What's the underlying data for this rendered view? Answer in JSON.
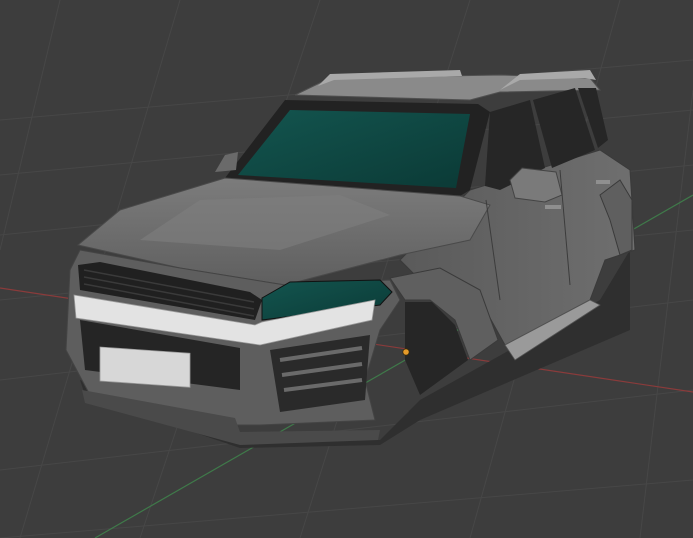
{
  "viewport": {
    "background": "#3d3d3d",
    "grid_color": "#474747",
    "x_axis_color": "#8a3b3b",
    "y_axis_color": "#3f7a4a"
  },
  "model": {
    "body_color": "#6e6e6e",
    "body_dark": "#4f4f4f",
    "glass_color": "#0f4a45",
    "chrome_color": "#e3e3e3",
    "trim_color": "#2a2a2a",
    "origin_color": "#e69b2a"
  }
}
